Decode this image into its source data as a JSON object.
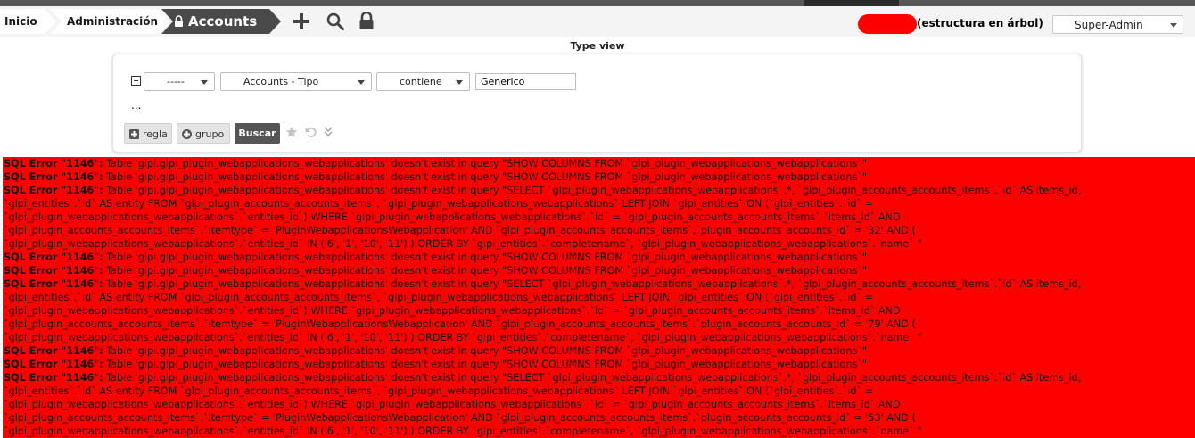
{
  "breadcrumb": {
    "home": "Inicio",
    "admin": "Administración",
    "current": "Accounts"
  },
  "toolbar": {
    "add_icon": "plus-icon",
    "search_icon": "search-icon",
    "lock_icon": "lock-icon"
  },
  "header": {
    "entity_label": "(estructura en árbol)",
    "profile_value": "Super-Admin"
  },
  "search": {
    "title": "Type view",
    "link_select": "-----",
    "field_select": "Accounts - Tipo",
    "operator_select": "contiene",
    "value": "Generico",
    "more": "...",
    "add_rule": "regla",
    "add_group": "grupo",
    "submit": "Buscar"
  },
  "errors": [
    {
      "label": "SQL Error \"1146\":",
      "text": " Table 'glpi.glpi_plugin_webapplications_webapplications' doesn't exist in query \"SHOW COLUMNS FROM `glpi_plugin_webapplications_webapplications`\""
    },
    {
      "label": "SQL Error \"1146\":",
      "text": " Table 'glpi.glpi_plugin_webapplications_webapplications' doesn't exist in query \"SHOW COLUMNS FROM `glpi_plugin_webapplications_webapplications`\""
    },
    {
      "label": "SQL Error \"1146\":",
      "text": " Table 'glpi.glpi_plugin_webapplications_webapplications' doesn't exist in query \"SELECT `glpi_plugin_webapplications_webapplications`.*, `glpi_plugin_accounts_accounts_items`.`id` AS items_id,"
    },
    {
      "label": "",
      "text": "`glpi_entities`.`id` AS entity FROM `glpi_plugin_accounts_accounts_items`, `glpi_plugin_webapplications_webapplications` LEFT JOIN `glpi_entities` ON (`glpi_entities`.`id` ="
    },
    {
      "label": "",
      "text": "`glpi_plugin_webapplications_webapplications`.`entities_id`) WHERE `glpi_plugin_webapplications_webapplications`.`id` = `glpi_plugin_accounts_accounts_items`.`items_id` AND"
    },
    {
      "label": "",
      "text": "`glpi_plugin_accounts_accounts_items`.`itemtype` = 'PluginWebapplicationsWebapplication' AND `glpi_plugin_accounts_accounts_items`.`plugin_accounts_accounts_id` = '32' AND ("
    },
    {
      "label": "",
      "text": "`glpi_plugin_webapplications_webapplications`.`entities_id` IN ('6', '1', '10', '11') ) ORDER BY `glpi_entities`.`completename`, `glpi_plugin_webapplications_webapplications`.`name` \""
    },
    {
      "label": "SQL Error \"1146\":",
      "text": " Table 'glpi.glpi_plugin_webapplications_webapplications' doesn't exist in query \"SHOW COLUMNS FROM `glpi_plugin_webapplications_webapplications`\""
    },
    {
      "label": "SQL Error \"1146\":",
      "text": " Table 'glpi.glpi_plugin_webapplications_webapplications' doesn't exist in query \"SHOW COLUMNS FROM `glpi_plugin_webapplications_webapplications`\""
    },
    {
      "label": "SQL Error \"1146\":",
      "text": " Table 'glpi.glpi_plugin_webapplications_webapplications' doesn't exist in query \"SELECT `glpi_plugin_webapplications_webapplications`.*, `glpi_plugin_accounts_accounts_items`.`id` AS items_id,"
    },
    {
      "label": "",
      "text": "`glpi_entities`.`id` AS entity FROM `glpi_plugin_accounts_accounts_items`, `glpi_plugin_webapplications_webapplications` LEFT JOIN `glpi_entities` ON (`glpi_entities`.`id` ="
    },
    {
      "label": "",
      "text": "`glpi_plugin_webapplications_webapplications`.`entities_id`) WHERE `glpi_plugin_webapplications_webapplications`.`id` = `glpi_plugin_accounts_accounts_items`.`items_id` AND"
    },
    {
      "label": "",
      "text": "`glpi_plugin_accounts_accounts_items`.`itemtype` = 'PluginWebapplicationsWebapplication' AND `glpi_plugin_accounts_accounts_items`.`plugin_accounts_accounts_id` = '79' AND ("
    },
    {
      "label": "",
      "text": "`glpi_plugin_webapplications_webapplications`.`entities_id` IN ('6', '1', '10', '11') ) ORDER BY `glpi_entities`.`completename`, `glpi_plugin_webapplications_webapplications`.`name` \""
    },
    {
      "label": "SQL Error \"1146\":",
      "text": " Table 'glpi.glpi_plugin_webapplications_webapplications' doesn't exist in query \"SHOW COLUMNS FROM `glpi_plugin_webapplications_webapplications`\""
    },
    {
      "label": "SQL Error \"1146\":",
      "text": " Table 'glpi.glpi_plugin_webapplications_webapplications' doesn't exist in query \"SHOW COLUMNS FROM `glpi_plugin_webapplications_webapplications`\""
    },
    {
      "label": "SQL Error \"1146\":",
      "text": " Table 'glpi.glpi_plugin_webapplications_webapplications' doesn't exist in query \"SELECT `glpi_plugin_webapplications_webapplications`.*, `glpi_plugin_accounts_accounts_items`.`id` AS items_id,"
    },
    {
      "label": "",
      "text": "`glpi_entities`.`id` AS entity FROM `glpi_plugin_accounts_accounts_items`, `glpi_plugin_webapplications_webapplications` LEFT JOIN `glpi_entities` ON (`glpi_entities`.`id` ="
    },
    {
      "label": "",
      "text": "`glpi_plugin_webapplications_webapplications`.`entities_id`) WHERE `glpi_plugin_webapplications_webapplications`.`id` = `glpi_plugin_accounts_accounts_items`.`items_id` AND"
    },
    {
      "label": "",
      "text": "`glpi_plugin_accounts_accounts_items`.`itemtype` = 'PluginWebapplicationsWebapplication' AND `glpi_plugin_accounts_accounts_items`.`plugin_accounts_accounts_id` = '53' AND ("
    },
    {
      "label": "",
      "text": "`glpi_plugin_webapplications_webapplications`.`entities_id` IN ('6', '1', '10', '11') ) ORDER BY `glpi_entities`.`completename`, `glpi_plugin_webapplications_webapplications`.`name` \""
    }
  ],
  "colors": {
    "error_background": "#ff0000",
    "active_crumb": "#4a4a4a",
    "submit_button": "#555555"
  }
}
